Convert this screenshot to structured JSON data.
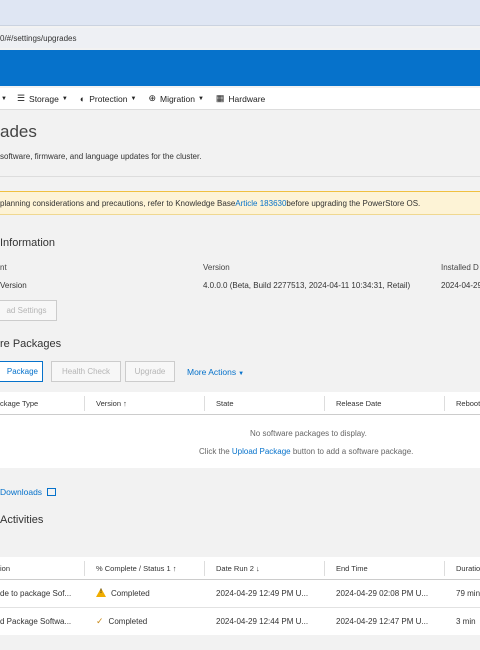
{
  "browser": {
    "url": "0/#/settings/upgrades"
  },
  "nav": {
    "items": [
      {
        "label": "Storage"
      },
      {
        "label": "Protection"
      },
      {
        "label": "Migration"
      },
      {
        "label": "Hardware"
      }
    ]
  },
  "page": {
    "title": "ades",
    "subtitle": "software, firmware, and language updates for the cluster."
  },
  "alert": {
    "text_before": "planning considerations and precautions, refer to Knowledge Base ",
    "link": "Article 183630",
    "text_after": " before upgrading the PowerStore OS."
  },
  "info": {
    "section_title": "Information",
    "col_component": "nt",
    "col_version": "Version",
    "col_installed": "Installed D",
    "row_component": "Version",
    "row_version": "4.0.0.0 (Beta, Build 2277513, 2024-04-11 10:34:31, Retail)",
    "row_installed": "2024-04-29",
    "download_settings_label": "ad Settings"
  },
  "packages": {
    "section_title": "re Packages",
    "upload_label": "Package",
    "health_check_label": "Health Check",
    "upgrade_label": "Upgrade",
    "more_actions_label": "More Actions",
    "columns": {
      "type": "ckage Type",
      "version": "Version",
      "version_sort": "↑",
      "state": "State",
      "release_date": "Release Date",
      "reboot": "Reboot"
    },
    "empty_message": "No software packages to display.",
    "empty_hint_before": "Click the ",
    "empty_hint_link": "Upload Package",
    "empty_hint_after": " button to add a software package."
  },
  "downloads": {
    "label": "Downloads"
  },
  "activities": {
    "section_title": "Activities",
    "columns": {
      "name": "ion",
      "status": "% Complete / Status",
      "status_sort_order": "1",
      "status_sort": "↑",
      "date_run": "Date Run",
      "date_run_sort_order": "2",
      "date_run_sort": "↓",
      "end_time": "End Time",
      "duration": "Duratio"
    },
    "rows": [
      {
        "name": "de to package Sof...",
        "status": "Completed",
        "status_icon": "warning-icon",
        "date_run": "2024-04-29 12:49 PM U...",
        "end_time": "2024-04-29 02:08 PM U...",
        "duration": "79 min"
      },
      {
        "name": "d Package Softwa...",
        "status": "Completed",
        "status_icon": "check-icon",
        "date_run": "2024-04-29 12:44 PM U...",
        "end_time": "2024-04-29 12:47 PM U...",
        "duration": "3 min"
      }
    ]
  },
  "colors": {
    "brand": "#0672cb",
    "alert_bg": "#fdf3d6",
    "warning": "#f0ad00"
  }
}
